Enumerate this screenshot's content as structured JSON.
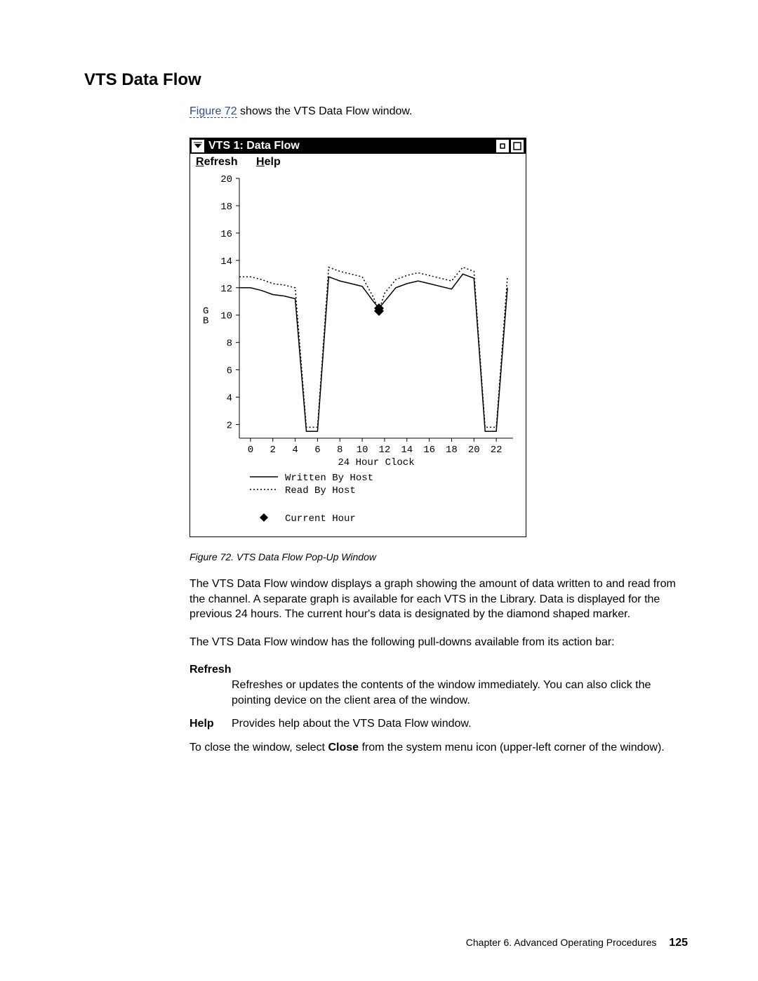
{
  "heading": "VTS Data Flow",
  "intro_link": "Figure 72",
  "intro_rest": " shows the VTS Data Flow window.",
  "popup": {
    "title": "VTS 1: Data Flow",
    "menu_refresh": "Refresh",
    "menu_help": "Help"
  },
  "chart_data": {
    "type": "line",
    "xlabel": "24 Hour Clock",
    "ylabel": "GB",
    "x_ticks": [
      0,
      2,
      4,
      6,
      8,
      10,
      12,
      14,
      16,
      18,
      20,
      22
    ],
    "y_ticks": [
      2,
      4,
      6,
      8,
      10,
      12,
      14,
      16,
      18,
      20
    ],
    "xlim": [
      -1,
      23.5
    ],
    "ylim": [
      1,
      20
    ],
    "series": [
      {
        "name": "Written By Host",
        "style": "solid",
        "values": [
          [
            -1,
            12.0
          ],
          [
            0,
            12.0
          ],
          [
            1,
            11.8
          ],
          [
            2,
            11.5
          ],
          [
            3,
            11.4
          ],
          [
            4,
            11.2
          ],
          [
            5,
            1.5
          ],
          [
            6,
            1.5
          ],
          [
            7,
            12.8
          ],
          [
            8,
            12.5
          ],
          [
            9,
            12.3
          ],
          [
            10,
            12.1
          ],
          [
            11,
            11.0
          ],
          [
            11.5,
            10.5
          ],
          [
            12,
            11.0
          ],
          [
            13,
            12.0
          ],
          [
            14,
            12.3
          ],
          [
            15,
            12.5
          ],
          [
            16,
            12.3
          ],
          [
            17,
            12.1
          ],
          [
            18,
            11.9
          ],
          [
            19,
            13.0
          ],
          [
            20,
            12.7
          ],
          [
            21,
            1.5
          ],
          [
            22,
            1.5
          ],
          [
            23,
            12.0
          ]
        ]
      },
      {
        "name": "Read By Host",
        "style": "dotted",
        "values": [
          [
            -1,
            12.8
          ],
          [
            0,
            12.8
          ],
          [
            1,
            12.6
          ],
          [
            2,
            12.3
          ],
          [
            3,
            12.2
          ],
          [
            4,
            12.0
          ],
          [
            5,
            1.8
          ],
          [
            6,
            1.8
          ],
          [
            7,
            13.5
          ],
          [
            8,
            13.2
          ],
          [
            9,
            13.0
          ],
          [
            10,
            12.8
          ],
          [
            11,
            11.3
          ],
          [
            11.5,
            10.3
          ],
          [
            12,
            11.6
          ],
          [
            13,
            12.6
          ],
          [
            14,
            12.9
          ],
          [
            15,
            13.1
          ],
          [
            16,
            12.9
          ],
          [
            17,
            12.7
          ],
          [
            18,
            12.5
          ],
          [
            19,
            13.5
          ],
          [
            20,
            13.2
          ],
          [
            21,
            1.8
          ],
          [
            22,
            1.8
          ],
          [
            23,
            12.8
          ]
        ]
      }
    ],
    "current_hour_points": [
      {
        "series": "Written By Host",
        "x": 11.5,
        "y": 10.5
      },
      {
        "series": "Read By Host",
        "x": 11.5,
        "y": 10.3
      }
    ],
    "legend": {
      "series1": "Written By Host",
      "series2": "Read By Host",
      "marker": "Current Hour"
    }
  },
  "caption": "Figure 72. VTS Data Flow Pop-Up Window",
  "p1": "The VTS Data Flow window displays a graph showing the amount of data written to and read from the channel. A separate graph is available for each VTS in the Library. Data is displayed for the previous 24 hours. The current hour's data is designated by the diamond shaped marker.",
  "p2": "The VTS Data Flow window has the following pull-downs available from its action bar:",
  "dl": {
    "refresh_label": "Refresh",
    "refresh_text": "Refreshes or updates the contents of the window immediately. You can also click the pointing device on the client area of the window.",
    "help_label": "Help",
    "help_text": "Provides help about the VTS Data Flow window."
  },
  "p3a": "To close the window, select ",
  "p3b": "Close",
  "p3c": " from the system menu icon (upper-left corner of the window).",
  "footer_chapter": "Chapter 6. Advanced Operating Procedures",
  "footer_page": "125"
}
